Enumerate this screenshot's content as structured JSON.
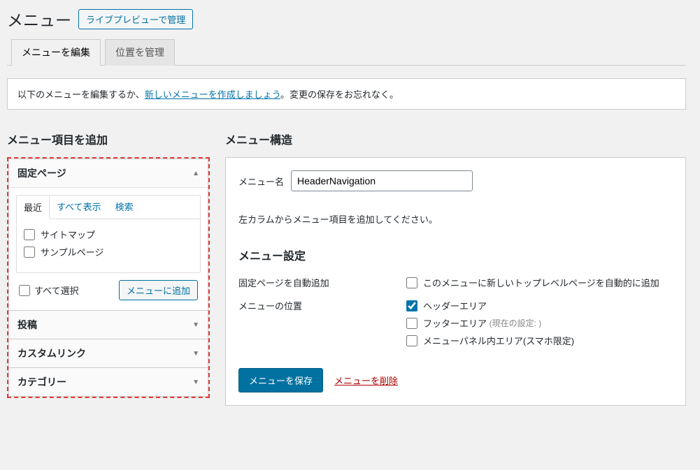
{
  "header": {
    "title": "メニュー",
    "live_preview_label": "ライブプレビューで管理"
  },
  "tabs": {
    "edit": "メニューを編集",
    "locations": "位置を管理"
  },
  "notice": {
    "prefix": "以下のメニューを編集するか、",
    "link": "新しいメニューを作成しましょう",
    "suffix": "。変更の保存をお忘れなく。"
  },
  "left": {
    "heading": "メニュー項目を追加",
    "accordion": {
      "pages": "固定ページ",
      "posts": "投稿",
      "custom": "カスタムリンク",
      "categories": "カテゴリー"
    },
    "innerTabs": {
      "recent": "最近",
      "all": "すべて表示",
      "search": "検索"
    },
    "pageItems": {
      "sitemap": "サイトマップ",
      "sample": "サンプルページ"
    },
    "selectAll": "すべて選択",
    "addToMenu": "メニューに追加"
  },
  "right": {
    "heading": "メニュー構造",
    "menuNameLabel": "メニュー名",
    "menuNameValue": "HeaderNavigation",
    "hint": "左カラムからメニュー項目を追加してください。",
    "settingsHeading": "メニュー設定",
    "rows": {
      "autoAddLabel": "固定ページを自動追加",
      "autoAddCheck": "このメニューに新しいトップレベルページを自動的に追加",
      "locationLabel": "メニューの位置",
      "locHeader": "ヘッダーエリア",
      "locFooter": "フッターエリア",
      "locFooterNote": "(現在の設定: )",
      "locPanel": "メニューパネル内エリア(スマホ限定)"
    },
    "save": "メニューを保存",
    "delete": "メニューを削除"
  }
}
